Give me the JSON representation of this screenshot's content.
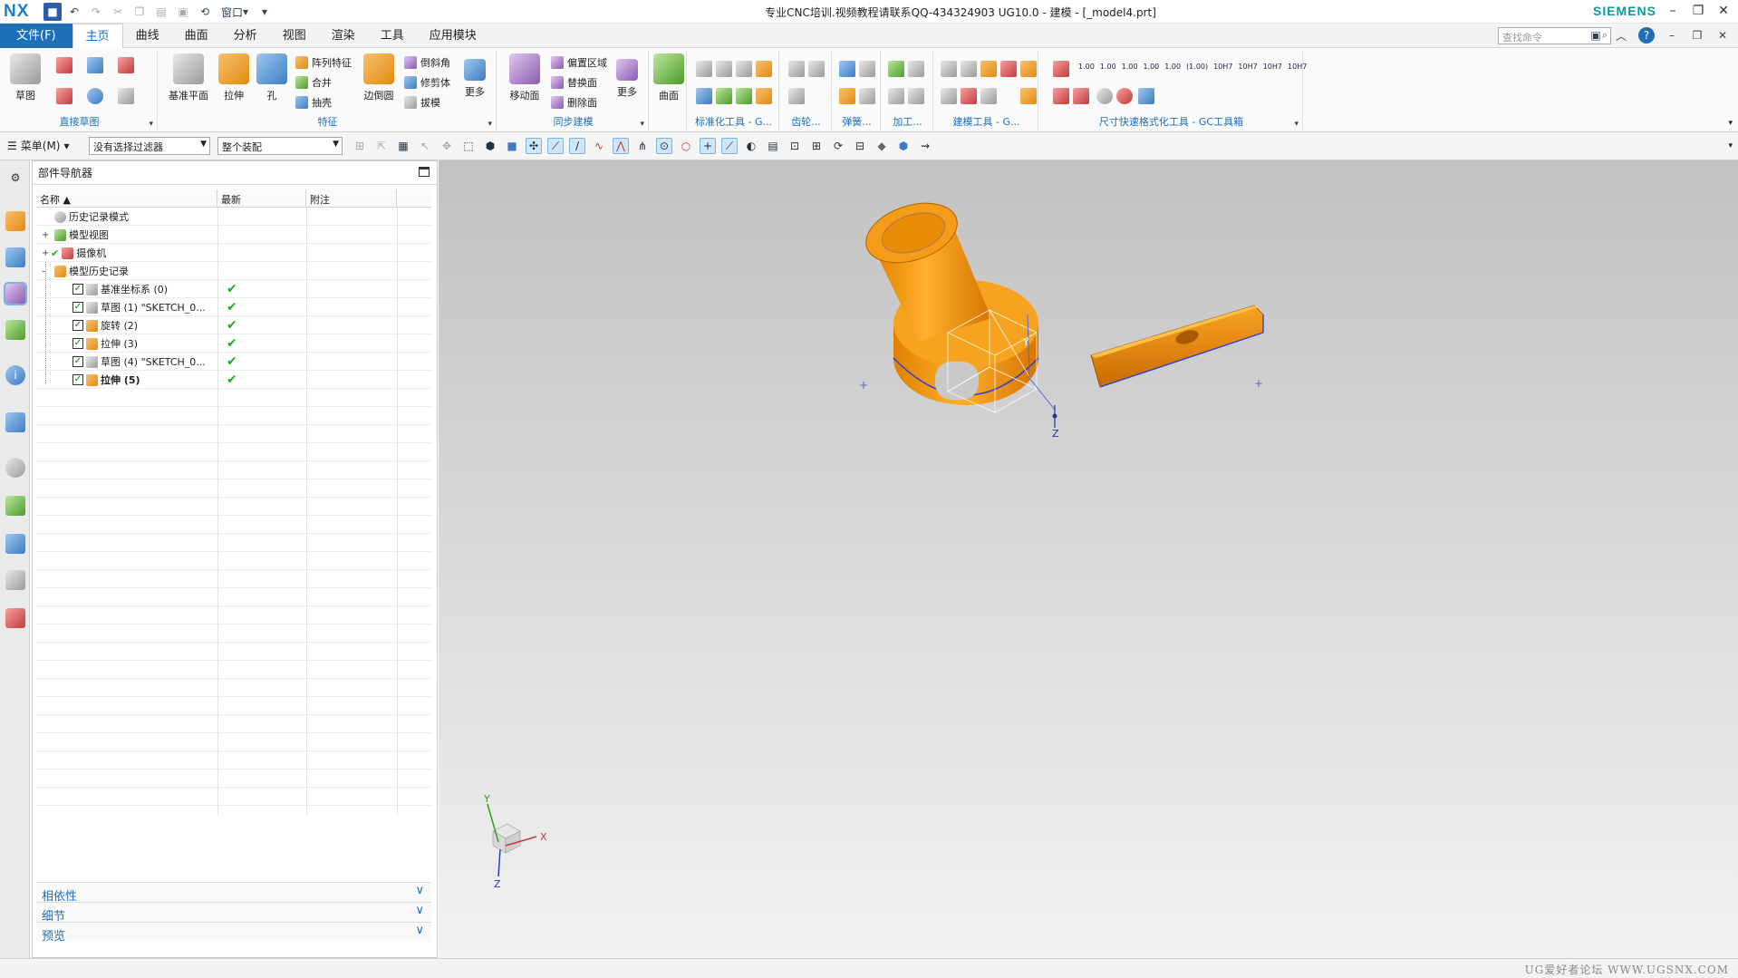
{
  "app": {
    "logo": "NX",
    "window_title": "专业CNC培训.视频教程请联系QQ-434324903 UG10.0 - 建模 - [_model4.prt]",
    "brand": "SIEMENS",
    "quick_window": "窗口"
  },
  "tabs": [
    {
      "label": "文件(F)"
    },
    {
      "label": "主页"
    },
    {
      "label": "曲线"
    },
    {
      "label": "曲面"
    },
    {
      "label": "分析"
    },
    {
      "label": "视图"
    },
    {
      "label": "渲染"
    },
    {
      "label": "工具"
    },
    {
      "label": "应用模块"
    }
  ],
  "search": {
    "placeholder": "查找命令"
  },
  "ribbon": {
    "sketch": {
      "label": "直接草图",
      "btn": "草图"
    },
    "datum": {
      "label": "基准平面"
    },
    "feature": {
      "label": "特征",
      "extrude": "拉伸",
      "hole": "孔",
      "pattern": "阵列特征",
      "unite": "合并",
      "shell": "抽壳",
      "edge_blend": "边倒圆",
      "chamfer": "倒斜角",
      "trim": "修剪体",
      "draft": "拔模",
      "more": "更多"
    },
    "sync": {
      "label": "同步建模",
      "move_face": "移动面",
      "offset_region": "偏置区域",
      "replace_face": "替换面",
      "delete_face": "删除面",
      "more": "更多"
    },
    "surface": {
      "btn": "曲面"
    },
    "std": {
      "label": "标准化工具 - G..."
    },
    "gear": {
      "label": "齿轮..."
    },
    "spring": {
      "label": "弹簧..."
    },
    "machining": {
      "label": "加工..."
    },
    "modeling": {
      "label": "建模工具 - G..."
    },
    "dim": {
      "label": "尺寸快速格式化工具 - GC工具箱",
      "tags": [
        "1.00",
        "1.00",
        "1.00",
        "1.00",
        "1.00",
        "(1.00)",
        "10H7",
        "10H7",
        "10H7",
        "10H7"
      ]
    }
  },
  "selbar": {
    "menu": "菜单(M)",
    "filter": "没有选择过滤器",
    "scope": "整个装配"
  },
  "navigator": {
    "title": "部件导航器",
    "columns": [
      "名称",
      "最新",
      "附注"
    ],
    "items": [
      {
        "label": "历史记录模式"
      },
      {
        "label": "模型视图"
      },
      {
        "label": "摄像机"
      },
      {
        "label": "模型历史记录"
      },
      {
        "label": "基准坐标系 (0)"
      },
      {
        "label": "草图 (1) \"SKETCH_0..."
      },
      {
        "label": "旋转 (2)"
      },
      {
        "label": "拉伸 (3)"
      },
      {
        "label": "草图 (4) \"SKETCH_0..."
      },
      {
        "label": "拉伸 (5)"
      }
    ],
    "panels": [
      "相依性",
      "细节",
      "预览"
    ]
  },
  "viewport": {
    "axis_x": "X",
    "axis_y": "Y",
    "axis_z": "Z"
  },
  "watermark": "UG爱好者论坛 WWW.UGSNX.COM",
  "colors": {
    "accent": "#1d6fb8",
    "model": "#f39a0e",
    "brand": "#0a9a9a"
  }
}
